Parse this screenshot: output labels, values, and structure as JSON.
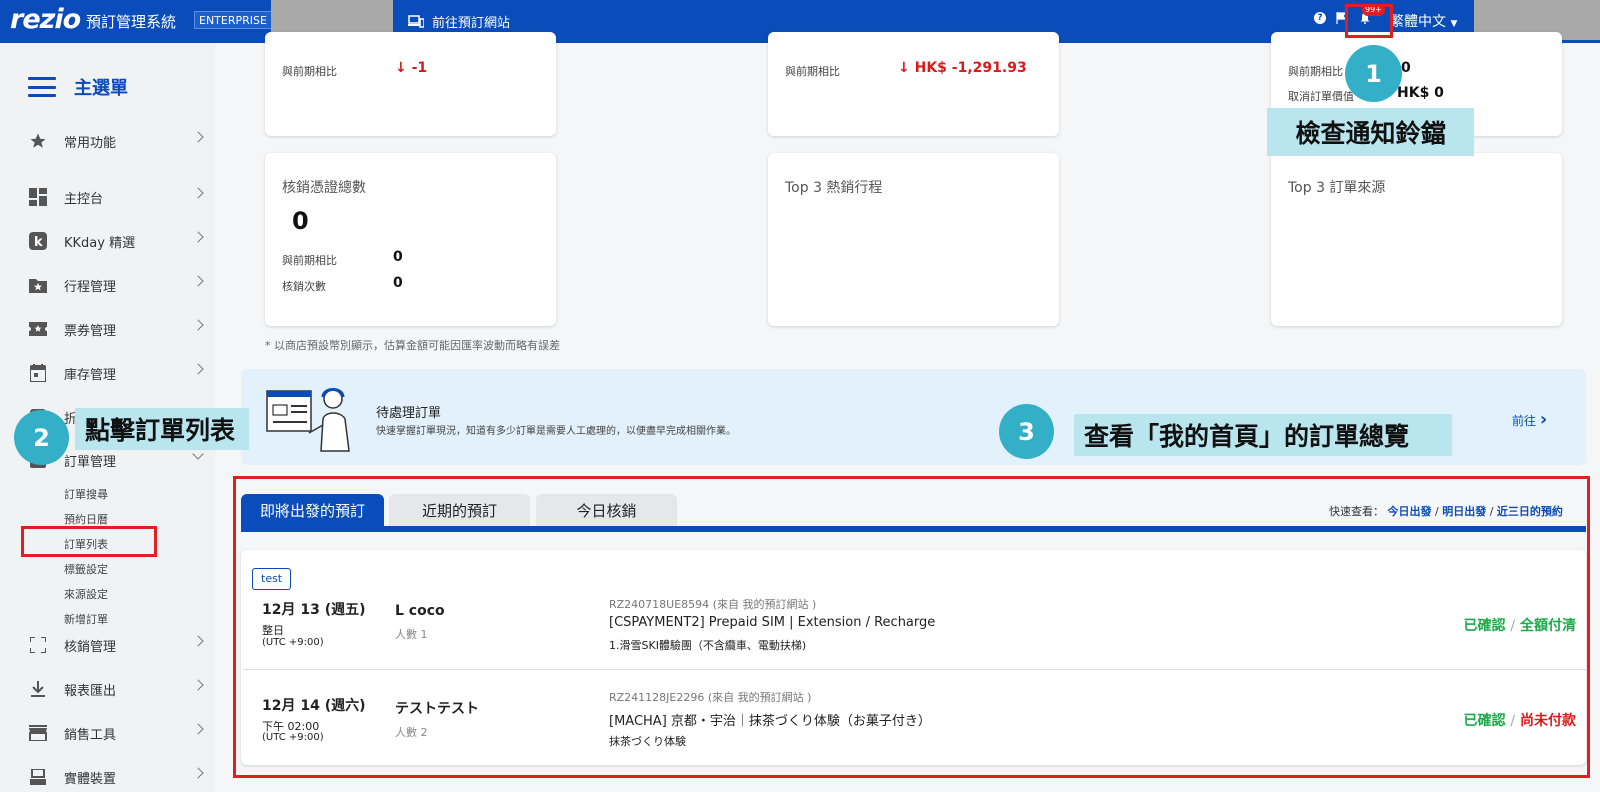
{
  "topbar": {
    "logo": "rezio",
    "system_name": "預訂管理系統",
    "edition_badge": "ENTERPRISE",
    "go_site": "前往預訂網站",
    "help_icon": "help-circle-icon",
    "notification_badge": "99+",
    "language": "繁體中文",
    "bg_color": "#0a4cb9"
  },
  "sidebar": {
    "title": "主選單",
    "items": [
      {
        "label": "常用功能",
        "icon": "star-icon"
      },
      {
        "label": "主控台",
        "icon": "dashboard-icon"
      },
      {
        "label": "KKday 精選",
        "icon": "kkday-icon"
      },
      {
        "label": "行程管理",
        "icon": "folder-star-icon"
      },
      {
        "label": "票券管理",
        "icon": "ticket-icon"
      },
      {
        "label": "庫存管理",
        "icon": "calendar-icon"
      },
      {
        "label": "折",
        "icon": "discount-icon"
      },
      {
        "label": "訂單管理",
        "icon": "order-icon"
      },
      {
        "label": "核銷管理",
        "icon": "scan-icon"
      },
      {
        "label": "報表匯出",
        "icon": "download-icon"
      },
      {
        "label": "銷售工具",
        "icon": "store-icon"
      },
      {
        "label": "實體裝置",
        "icon": "device-icon"
      }
    ],
    "order_sub": [
      "訂單搜尋",
      "預約日曆",
      "訂單列表",
      "標籤設定",
      "來源設定",
      "新增訂單"
    ]
  },
  "stats": {
    "card1": {
      "compare_label": "與前期相比",
      "compare_value": "-1"
    },
    "card2": {
      "compare_label": "與前期相比",
      "compare_value": "HK$ -1,291.93"
    },
    "card3": {
      "compare_label": "與前期相比",
      "compare_value": "0",
      "cancel_label": "取消訂單價值",
      "cancel_value": "HK$ 0"
    },
    "verify": {
      "title": "核銷憑證總數",
      "total": "0",
      "compare_label": "與前期相比",
      "compare_value": "0",
      "count_label": "核銷次數",
      "count_value": "0"
    },
    "top3_tours": "Top 3 熱銷行程",
    "top3_sources": "Top 3 訂單來源",
    "note": "* 以商店預設幣別顯示，估算金額可能因匯率波動而略有誤差"
  },
  "banner": {
    "title": "待處理訂單",
    "desc": "快速掌握訂單現況，知道有多少訂單是需要人工處理的，以便盡早完成相關作業。",
    "link": "前往"
  },
  "callouts": {
    "one": {
      "num": "1",
      "text": "檢查通知鈴鐺"
    },
    "two": {
      "num": "2",
      "text": "點擊訂單列表"
    },
    "three": {
      "num": "3",
      "text": "查看「我的首頁」的訂單總覽"
    }
  },
  "tabs": [
    "即將出發的預訂",
    "近期的預訂",
    "今日核銷"
  ],
  "quick": {
    "label": "快速查看：",
    "links": [
      "今日出發",
      "明日出發",
      "近三日的預約"
    ]
  },
  "orders": [
    {
      "tag": "test",
      "date": "12月 13 (週五)",
      "time": "整日",
      "tz": "(UTC +9:00)",
      "name": "L coco",
      "people": "人數 1",
      "order_no": "RZ240718UE8594 (來自 我的預訂網站 )",
      "product": "[CSPAYMENT2] Prepaid SIM | Extension / Recharge",
      "plan": "1.滑雪SKI體驗團（不含纜車、電動扶梯)",
      "status1": "已確認",
      "status2": "全額付清"
    },
    {
      "date": "12月 14 (週六)",
      "time": "下午 02:00",
      "tz": "(UTC +9:00)",
      "name": "テストテスト",
      "people": "人數 2",
      "order_no": "RZ241128JE2296 (來自 我的預訂網站 )",
      "product": "[MACHA] 京都・宇治｜抹茶づくり体験（お菓子付き）",
      "plan": "抹茶づくり体験",
      "status1": "已確認",
      "status2": "尚未付款"
    }
  ]
}
